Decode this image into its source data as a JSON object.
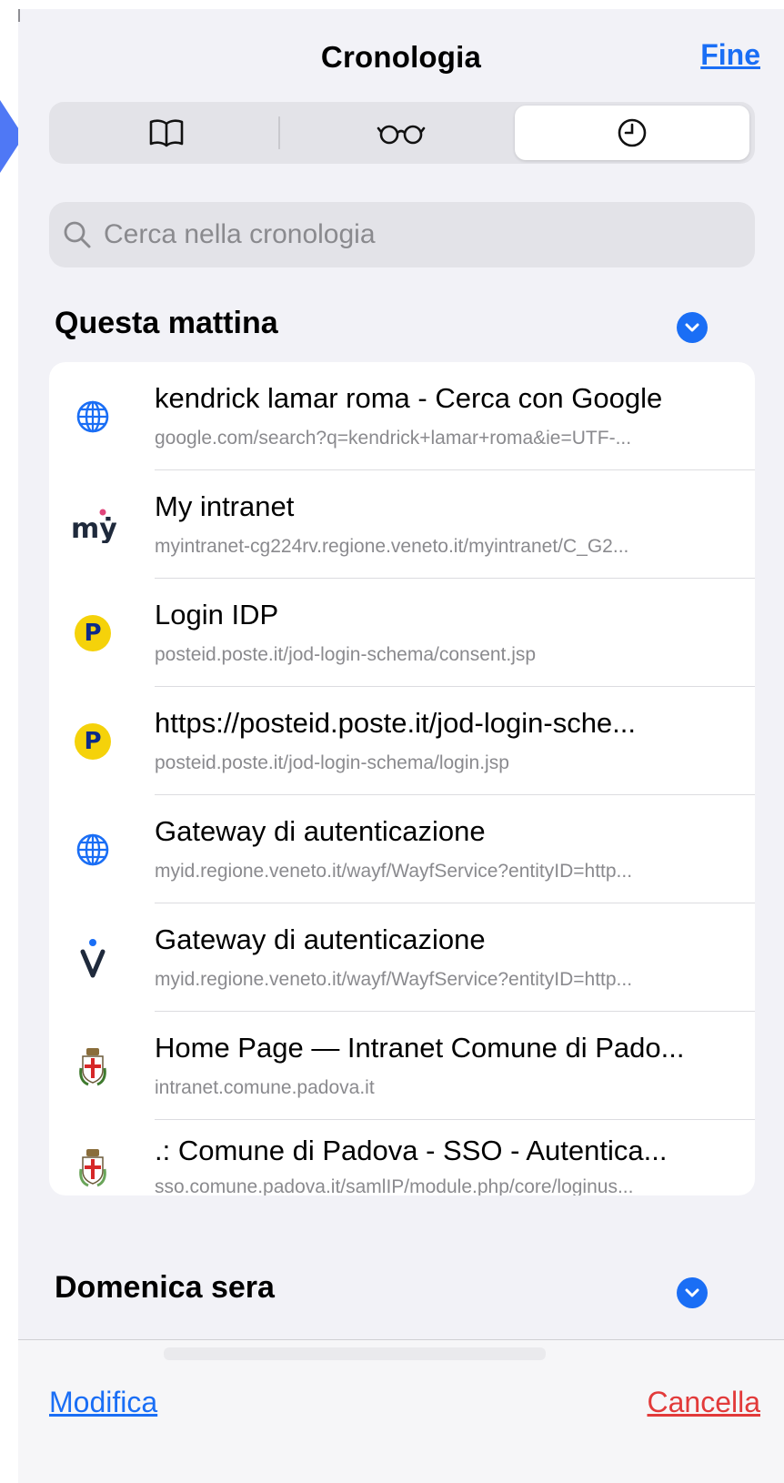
{
  "header": {
    "title": "Cronologia",
    "done_label": "Fine"
  },
  "segments": [
    {
      "icon": "book-icon"
    },
    {
      "icon": "glasses-icon"
    },
    {
      "icon": "clock-icon",
      "selected": true
    }
  ],
  "search": {
    "placeholder": "Cerca nella cronologia"
  },
  "sections": [
    {
      "title": "Questa mattina",
      "items": [
        {
          "icon": "globe-icon",
          "title": "kendrick lamar roma - Cerca con Google",
          "url": "google.com/search?q=kendrick+lamar+roma&ie=UTF-..."
        },
        {
          "icon": "myintranet-favicon",
          "title": "My intranet",
          "url": "myintranet-cg224rv.regione.veneto.it/myintranet/C_G2..."
        },
        {
          "icon": "poste-favicon",
          "title": "Login IDP",
          "url": "posteid.poste.it/jod-login-schema/consent.jsp"
        },
        {
          "icon": "poste-favicon",
          "title": "https://posteid.poste.it/jod-login-sche...",
          "url": "posteid.poste.it/jod-login-schema/login.jsp"
        },
        {
          "icon": "globe-icon",
          "title": "Gateway di autenticazione",
          "url": "myid.regione.veneto.it/wayf/WayfService?entityID=http..."
        },
        {
          "icon": "myid-favicon",
          "title": "Gateway di autenticazione",
          "url": "myid.regione.veneto.it/wayf/WayfService?entityID=http..."
        },
        {
          "icon": "padova-crest-favicon",
          "title": "Home Page — Intranet Comune di Pado...",
          "url": "intranet.comune.padova.it"
        },
        {
          "icon": "padova-crest-favicon",
          "title": ".: Comune di Padova - SSO - Autentica...",
          "url": "sso.comune.padova.it/samlIP/module.php/core/loginus..."
        }
      ]
    },
    {
      "title": "Domenica sera"
    }
  ],
  "toolbar": {
    "edit_label": "Modifica",
    "clear_label": "Cancella"
  },
  "colors": {
    "accent": "#1a6ef5",
    "destructive": "#e23a3a",
    "background": "#f2f2f7",
    "poste_yellow": "#f5d20a"
  }
}
